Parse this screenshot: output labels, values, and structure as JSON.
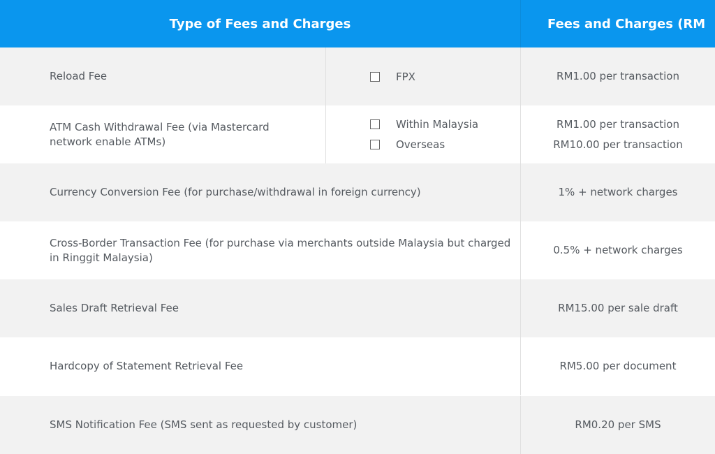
{
  "header": {
    "type_label": "Type of Fees and Charges",
    "fee_label": "Fees and Charges (RM"
  },
  "rows": [
    {
      "type": "Reload Fee",
      "options": [
        "FPX"
      ],
      "fees": [
        "RM1.00 per transaction"
      ]
    },
    {
      "type_line1": "ATM Cash Withdrawal Fee (via Mastercard",
      "type_line2": "network enable ATMs)",
      "options": [
        "Within Malaysia",
        "Overseas"
      ],
      "fees": [
        "RM1.00 per transaction",
        "RM10.00 per transaction"
      ]
    },
    {
      "type": "Currency Conversion Fee (for purchase/withdrawal in foreign currency)",
      "fees": [
        "1% + network charges"
      ]
    },
    {
      "type_line1": "Cross-Border Transaction Fee (for purchase via merchants outside Malaysia but charged",
      "type_line2": "in Ringgit Malaysia)",
      "fees": [
        "0.5% + network charges"
      ]
    },
    {
      "type": "Sales Draft Retrieval Fee",
      "fees": [
        "RM15.00 per sale draft"
      ]
    },
    {
      "type": "Hardcopy of Statement Retrieval Fee",
      "fees": [
        "RM5.00 per document"
      ]
    },
    {
      "type": "SMS Notification Fee (SMS sent as requested by customer)",
      "fees": [
        "RM0.20 per SMS"
      ]
    }
  ],
  "colors": {
    "header_bg": "#0a96ee",
    "row_gray": "#f2f2f2",
    "text": "#555a60"
  }
}
